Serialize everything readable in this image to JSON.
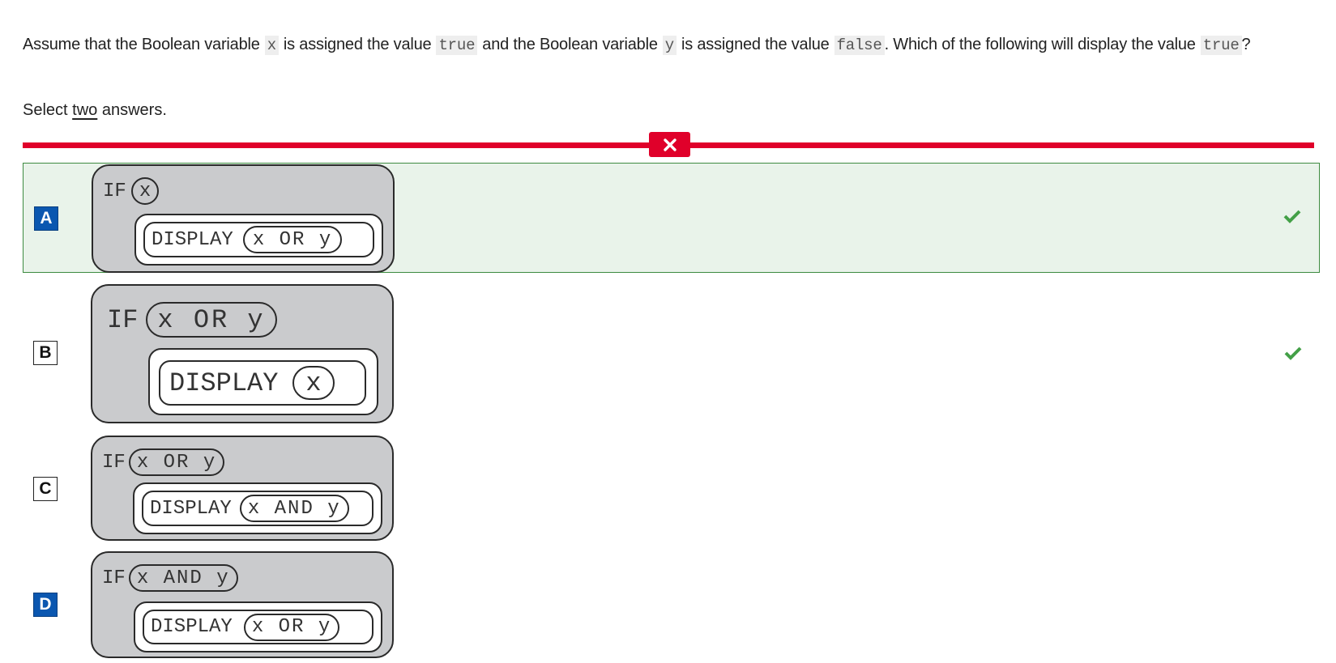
{
  "question": {
    "part1": "Assume that the Boolean variable",
    "var_x": "x",
    "part2": "is assigned the value",
    "val_true": "true",
    "part3": "and the Boolean variable",
    "var_y": "y",
    "part4": "is assigned the value",
    "val_false": "false",
    "part5": ". Which of the following will display the value",
    "val_true2": "true",
    "part6": "?"
  },
  "instruction": {
    "prefix": "Select",
    "emphasis": "two",
    "suffix": "answers."
  },
  "result": {
    "status": "incorrect",
    "icon": "close-icon",
    "color": "#e0002a"
  },
  "colors": {
    "selected_badge": "#0b57b0",
    "correct_bg": "#e9f3ea",
    "correct_border": "#3d8b40",
    "check": "#43a047",
    "block_gray": "#cacbcd"
  },
  "options": [
    {
      "letter": "A",
      "selected": true,
      "correct": true,
      "if_keyword": "IF",
      "condition": "x",
      "display_keyword": "DISPLAY",
      "display_expr": "x OR y"
    },
    {
      "letter": "B",
      "selected": false,
      "correct": true,
      "if_keyword": "IF",
      "condition": "x OR y",
      "display_keyword": "DISPLAY",
      "display_expr": "x"
    },
    {
      "letter": "C",
      "selected": false,
      "correct": false,
      "if_keyword": "IF",
      "condition": "x OR y",
      "display_keyword": "DISPLAY",
      "display_expr": "x AND y"
    },
    {
      "letter": "D",
      "selected": true,
      "correct": false,
      "if_keyword": "IF",
      "condition": "x AND y",
      "display_keyword": "DISPLAY",
      "display_expr": "x OR y"
    }
  ]
}
